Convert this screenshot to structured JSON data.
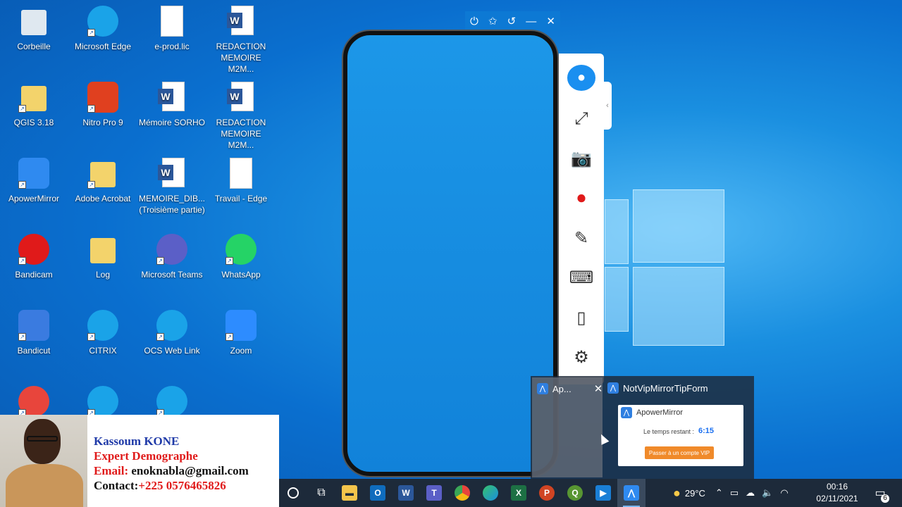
{
  "desktop_icons": [
    {
      "label": "Corbeille",
      "icon": "recycle-bin-icon",
      "color": "#dfe8f0"
    },
    {
      "label": "Microsoft Edge",
      "icon": "edge-icon",
      "color": "#1aa3e8"
    },
    {
      "label": "e-prod.lic",
      "icon": "file-icon",
      "color": "#ffffff"
    },
    {
      "label": "REDACTION MEMOIRE M2M...",
      "icon": "word-icon",
      "color": "#2b579a"
    },
    {
      "label": "QGIS 3.18",
      "icon": "folder-qgis-icon",
      "color": "#f3d36b"
    },
    {
      "label": "Nitro Pro 9",
      "icon": "nitro-icon",
      "color": "#e0401f"
    },
    {
      "label": "Mémoire SORHO",
      "icon": "word-icon",
      "color": "#2b579a"
    },
    {
      "label": "REDACTION MEMOIRE M2M...",
      "icon": "word-icon",
      "color": "#2b579a"
    },
    {
      "label": "ApowerMirror",
      "icon": "apowermirror-icon",
      "color": "#2f8af0"
    },
    {
      "label": "Adobe Acrobat",
      "icon": "folder-acrobat-icon",
      "color": "#f3d36b"
    },
    {
      "label": "MEMOIRE_DIB... (Troisième partie)",
      "icon": "word-icon",
      "color": "#2b579a"
    },
    {
      "label": "Travail - Edge",
      "icon": "file-icon",
      "color": "#ffffff"
    },
    {
      "label": "Bandicam",
      "icon": "bandicam-icon",
      "color": "#e01a1a"
    },
    {
      "label": "Log",
      "icon": "folder-icon",
      "color": "#f3d36b"
    },
    {
      "label": "Microsoft Teams",
      "icon": "teams-icon",
      "color": "#5b5fc7"
    },
    {
      "label": "WhatsApp",
      "icon": "whatsapp-icon",
      "color": "#25d366"
    },
    {
      "label": "Bandicut",
      "icon": "bandicut-icon",
      "color": "#3a7be0"
    },
    {
      "label": "CITRIX",
      "icon": "edge-icon",
      "color": "#1aa3e8"
    },
    {
      "label": "OCS Web Link",
      "icon": "edge-icon",
      "color": "#1aa3e8"
    },
    {
      "label": "Zoom",
      "icon": "zoom-icon",
      "color": "#2d8cff"
    },
    {
      "label": "",
      "icon": "chrome-icon",
      "color": "#e8453c"
    },
    {
      "label": "",
      "icon": "edge-legacy-icon",
      "color": "#1aa3e8"
    },
    {
      "label": "",
      "icon": "edge-icon",
      "color": "#1aa3e8"
    }
  ],
  "mirror_controls": [
    "power-icon",
    "pin-icon",
    "rotate-icon",
    "minimize-icon",
    "close-icon"
  ],
  "sidebar": [
    "user-icon",
    "fullscreen-icon",
    "camera-icon",
    "record-icon",
    "brush-icon",
    "keyboard-icon",
    "phone-icon",
    "gear-icon"
  ],
  "preview": {
    "left_title": "Ap...",
    "right_title": "NotVipMirrorTipForm",
    "tip_app": "ApowerMirror",
    "remaining_label": "Le temps restant :",
    "remaining_value": "6:15",
    "vip_button": "Passer à un compte VIP"
  },
  "contact": {
    "name": "Kassoum KONE",
    "role": "Expert Demographe",
    "email_label": "Email:",
    "email": "enoknabla@gmail.com",
    "contact_label": "Contact:",
    "phone": "+225 0576465826"
  },
  "taskbar": {
    "apps": [
      "search-icon",
      "task-view-icon",
      "file-explorer-icon",
      "outlook-icon",
      "word-icon",
      "teams-icon",
      "chrome-icon",
      "edge-icon",
      "excel-icon",
      "powerpoint-icon",
      "qgis-icon",
      "media-player-icon",
      "apowermirror-icon"
    ],
    "temperature": "29°C",
    "time": "00:16",
    "date": "02/11/2021",
    "notifications": "6"
  }
}
